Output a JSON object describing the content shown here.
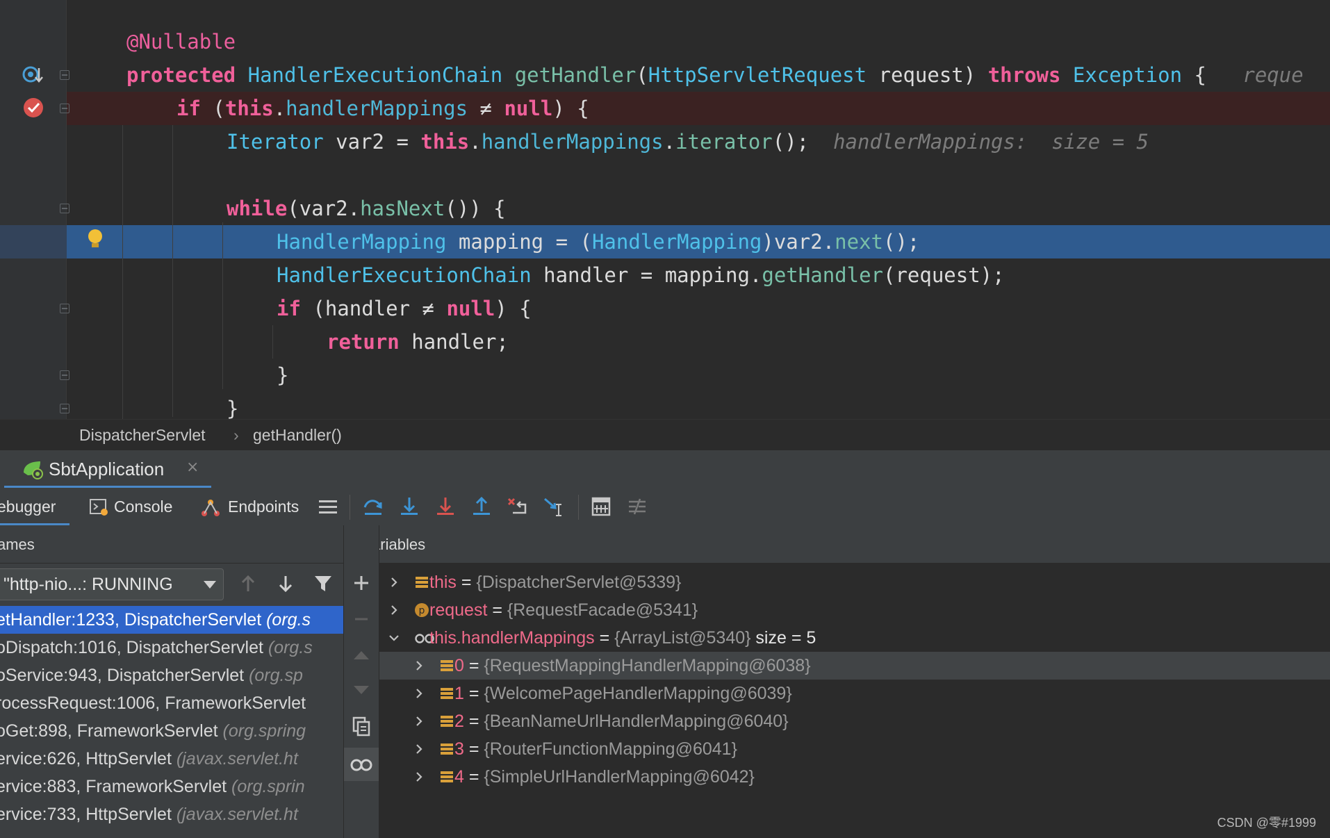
{
  "editor": {
    "lines": [
      {
        "tokens": [
          {
            "c": "ann",
            "t": "@Nullable"
          }
        ]
      },
      {
        "tokens": [
          {
            "c": "k",
            "t": "protected "
          },
          {
            "c": "t",
            "t": "HandlerExecutionChain "
          },
          {
            "c": "f",
            "t": "getHandler"
          },
          {
            "c": "p",
            "t": "("
          },
          {
            "c": "t",
            "t": "HttpServletRequest"
          },
          {
            "c": "p",
            "t": " request) "
          },
          {
            "c": "k",
            "t": "throws "
          },
          {
            "c": "t",
            "t": "Exception"
          },
          {
            "c": "p",
            "t": " {   "
          },
          {
            "c": "hint",
            "t": "reque"
          }
        ]
      },
      {
        "tokens": [
          {
            "c": "k",
            "t": "if "
          },
          {
            "c": "p",
            "t": "("
          },
          {
            "c": "k",
            "t": "this"
          },
          {
            "c": "p",
            "t": "."
          },
          {
            "c": "fld",
            "t": "handlerMappings"
          },
          {
            "c": "p",
            "t": " ≠ "
          },
          {
            "c": "k",
            "t": "null"
          },
          {
            "c": "p",
            "t": ") {"
          }
        ]
      },
      {
        "tokens": [
          {
            "c": "t",
            "t": "Iterator"
          },
          {
            "c": "p",
            "t": " var2 = "
          },
          {
            "c": "k",
            "t": "this"
          },
          {
            "c": "p",
            "t": "."
          },
          {
            "c": "fld",
            "t": "handlerMappings"
          },
          {
            "c": "p",
            "t": "."
          },
          {
            "c": "f",
            "t": "iterator"
          },
          {
            "c": "p",
            "t": "();  "
          },
          {
            "c": "hint",
            "t": "handlerMappings:  size = 5"
          }
        ]
      },
      {
        "tokens": []
      },
      {
        "tokens": [
          {
            "c": "k",
            "t": "while"
          },
          {
            "c": "p",
            "t": "(var2."
          },
          {
            "c": "f",
            "t": "hasNext"
          },
          {
            "c": "p",
            "t": "()) {"
          }
        ]
      },
      {
        "tokens": [
          {
            "c": "t",
            "t": "HandlerMapping"
          },
          {
            "c": "p",
            "t": " mapping = ("
          },
          {
            "c": "t",
            "t": "HandlerMapping"
          },
          {
            "c": "p",
            "t": ")var2."
          },
          {
            "c": "f",
            "t": "next"
          },
          {
            "c": "p",
            "t": "();"
          }
        ]
      },
      {
        "tokens": [
          {
            "c": "t",
            "t": "HandlerExecutionChain"
          },
          {
            "c": "p",
            "t": " handler = mapping."
          },
          {
            "c": "f",
            "t": "getHandler"
          },
          {
            "c": "p",
            "t": "(request);"
          }
        ]
      },
      {
        "tokens": [
          {
            "c": "k",
            "t": "if "
          },
          {
            "c": "p",
            "t": "(handler ≠ "
          },
          {
            "c": "k",
            "t": "null"
          },
          {
            "c": "p",
            "t": ") {"
          }
        ]
      },
      {
        "tokens": [
          {
            "c": "k",
            "t": "return "
          },
          {
            "c": "p",
            "t": "handler;"
          }
        ]
      },
      {
        "tokens": [
          {
            "c": "p",
            "t": "}"
          }
        ]
      },
      {
        "tokens": [
          {
            "c": "p",
            "t": "}"
          }
        ]
      }
    ]
  },
  "breadcrumb": {
    "class_name": "DispatcherServlet",
    "separator": "›",
    "method_name": "getHandler()"
  },
  "run_tab": {
    "label": "SbtApplication",
    "close": "×"
  },
  "debugger_tabs": {
    "debugger": "ebugger",
    "console": "Console",
    "endpoints": "Endpoints"
  },
  "frames": {
    "header": "ames",
    "thread": "\"http-nio...: RUNNING",
    "items": [
      {
        "name": "etHandler:1233, DispatcherServlet ",
        "pkg": "(org.s"
      },
      {
        "name": "oDispatch:1016, DispatcherServlet ",
        "pkg": "(org.s"
      },
      {
        "name": "oService:943, DispatcherServlet ",
        "pkg": "(org.sp"
      },
      {
        "name": "rocessRequest:1006, FrameworkServlet ",
        "pkg": ""
      },
      {
        "name": "oGet:898, FrameworkServlet ",
        "pkg": "(org.spring"
      },
      {
        "name": "ervice:626, HttpServlet ",
        "pkg": "(javax.servlet.ht"
      },
      {
        "name": "ervice:883, FrameworkServlet ",
        "pkg": "(org.sprin"
      },
      {
        "name": "ervice:733, HttpServlet ",
        "pkg": "(javax.servlet.ht"
      }
    ]
  },
  "variables": {
    "header": "Variables",
    "rows": [
      {
        "name": "this",
        "eq": " = ",
        "val": "{DispatcherServlet@5339}",
        "size": "",
        "icon": "field",
        "expanded": false,
        "indent": 0
      },
      {
        "name": "request",
        "eq": " = ",
        "val": "{RequestFacade@5341}",
        "size": "",
        "icon": "param",
        "expanded": false,
        "indent": 0
      },
      {
        "name": "this.handlerMappings",
        "eq": " = ",
        "val": "{ArrayList@5340}",
        "size": "  size = 5",
        "icon": "watch",
        "expanded": true,
        "indent": 0
      },
      {
        "name": "0",
        "eq": " = ",
        "val": "{RequestMappingHandlerMapping@6038}",
        "size": "",
        "icon": "field",
        "expanded": false,
        "indent": 1,
        "highlight": true
      },
      {
        "name": "1",
        "eq": " = ",
        "val": "{WelcomePageHandlerMapping@6039}",
        "size": "",
        "icon": "field",
        "expanded": false,
        "indent": 1
      },
      {
        "name": "2",
        "eq": " = ",
        "val": "{BeanNameUrlHandlerMapping@6040}",
        "size": "",
        "icon": "field",
        "expanded": false,
        "indent": 1
      },
      {
        "name": "3",
        "eq": " = ",
        "val": "{RouterFunctionMapping@6041}",
        "size": "",
        "icon": "field",
        "expanded": false,
        "indent": 1
      },
      {
        "name": "4",
        "eq": " = ",
        "val": "{SimpleUrlHandlerMapping@6042}",
        "size": "",
        "icon": "field",
        "expanded": false,
        "indent": 1
      }
    ]
  },
  "watermark": "CSDN @零#1999",
  "colors": {
    "keyword": "#f0609a",
    "type": "#4fc1e9",
    "method": "#79c0a8",
    "exec_line": "#2f5b8f",
    "selected_frame": "#2f65ca",
    "var_name": "#ef6a8a"
  }
}
